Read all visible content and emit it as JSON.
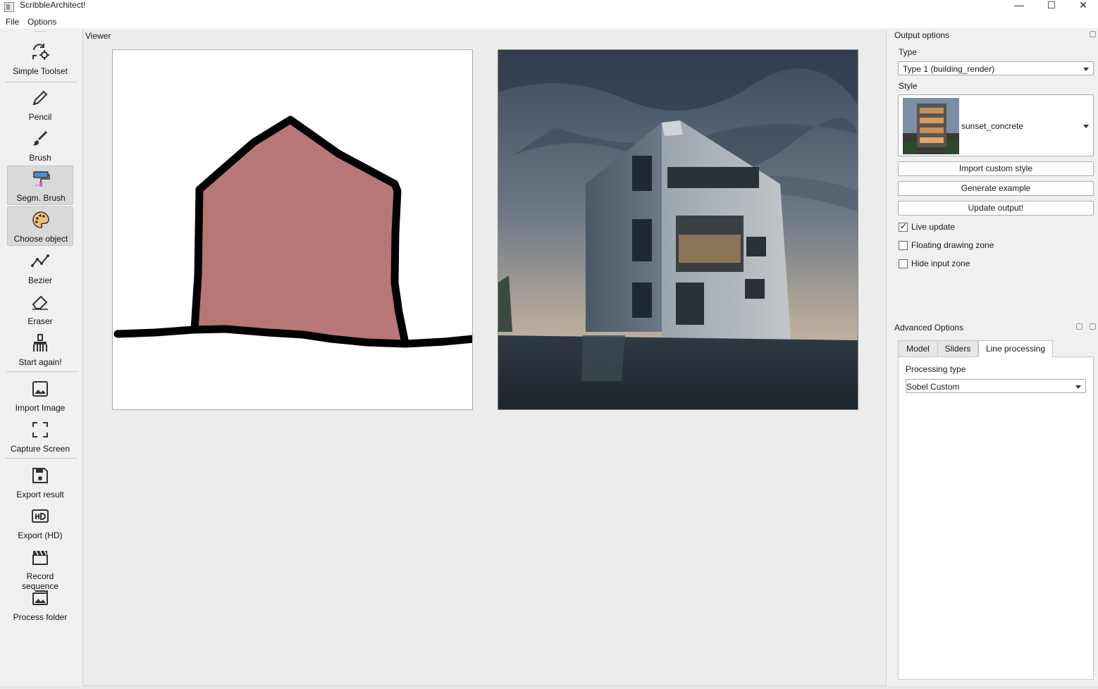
{
  "window": {
    "title": "ScribbleArchitect!",
    "controls": {
      "minimize": "—",
      "maximize": "☐",
      "close": "✕"
    }
  },
  "menu": {
    "items": [
      "File",
      "Options"
    ]
  },
  "toolbar": {
    "tools": [
      {
        "label": "Simple Toolset",
        "icon": "toolset-icon"
      },
      {
        "label": "Pencil",
        "icon": "pencil-icon"
      },
      {
        "label": "Brush",
        "icon": "brush-icon"
      },
      {
        "label": "Segm. Brush",
        "icon": "segmentation-brush-icon",
        "active": true
      },
      {
        "label": "Choose object",
        "icon": "palette-icon",
        "active": true
      },
      {
        "label": "Bezier",
        "icon": "bezier-icon"
      },
      {
        "label": "Eraser",
        "icon": "eraser-icon"
      },
      {
        "label": "Start again!",
        "icon": "broom-icon"
      },
      {
        "label": "Import Image",
        "icon": "image-icon"
      },
      {
        "label": "Capture Screen",
        "icon": "capture-icon"
      },
      {
        "label": "Export result",
        "icon": "save-icon"
      },
      {
        "label": "Export (HD)",
        "icon": "hd-icon"
      },
      {
        "label": "Record sequence",
        "icon": "clapper-icon"
      },
      {
        "label": "Process folder",
        "icon": "folder-images-icon"
      }
    ]
  },
  "viewer": {
    "label": "Viewer",
    "drawing_fill": "#b87777",
    "drawing_stroke": "#000000"
  },
  "output_options": {
    "title": "Output options",
    "type_label": "Type",
    "type_value": "Type 1 (building_render)",
    "style_label": "Style",
    "style_value": "sunset_concrete",
    "buttons": {
      "import": "Import custom style",
      "generate": "Generate example",
      "update": "Update output!"
    },
    "checkboxes": [
      {
        "label": "Live update",
        "checked": true
      },
      {
        "label": "Floating drawing zone",
        "checked": false
      },
      {
        "label": "Hide input zone",
        "checked": false
      }
    ]
  },
  "advanced_options": {
    "title": "Advanced Options",
    "tabs": [
      "Model",
      "Sliders",
      "Line processing"
    ],
    "active_tab": "Line processing",
    "processing_type_label": "Processing type",
    "processing_type_value": "Sobel Custom"
  }
}
